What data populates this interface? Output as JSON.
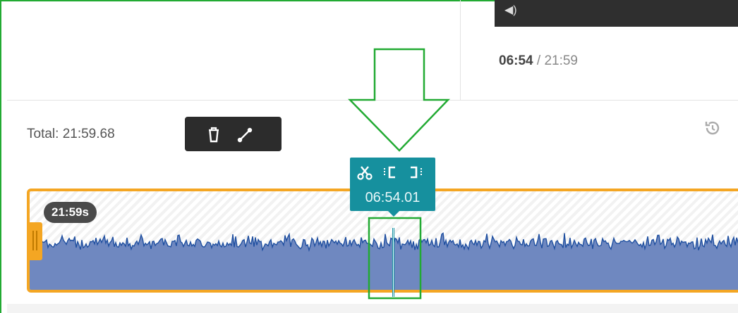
{
  "player": {
    "current_time": "06:54",
    "separator": "/",
    "duration": "21:59"
  },
  "editor": {
    "total_label": "Total: 21:59.68",
    "segment_badge": "21:59s",
    "toolbar": {
      "icons": [
        "trash-icon",
        "curve-edit-icon"
      ]
    },
    "history_icon": "history-icon",
    "cut_tooltip": {
      "time": "06:54.01",
      "icons": [
        "scissors-icon",
        "set-start-icon",
        "set-end-icon"
      ]
    }
  },
  "colors": {
    "track_border": "#f4a623",
    "waveform": "#1f4fa0",
    "waveform_fill": "#6f88c0",
    "tooltip": "#16909e",
    "annotation": "#22aa33"
  }
}
